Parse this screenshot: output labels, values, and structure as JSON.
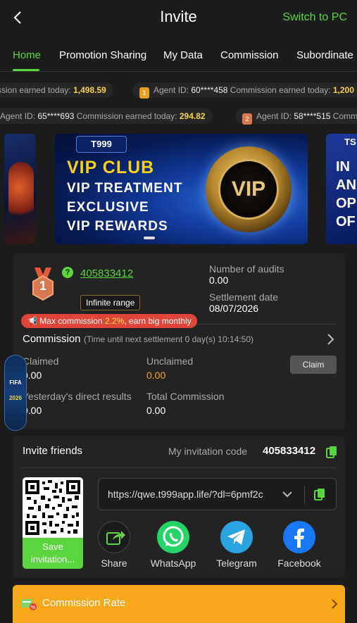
{
  "header": {
    "title": "Invite",
    "switch_label": "Switch to PC"
  },
  "tabs": [
    {
      "label": "Home"
    },
    {
      "label": "Promotion Sharing"
    },
    {
      "label": "My Data"
    },
    {
      "label": "Commission"
    },
    {
      "label": "Subordinate I"
    }
  ],
  "ticker_row1": [
    {
      "prefix": "ssion earned today:",
      "amount": "1,498.59"
    },
    {
      "medal": "1",
      "agent_label": "Agent ID:",
      "agent_id": "60****458",
      "earned_label": "Commission earned today:",
      "amount": "1,200"
    }
  ],
  "ticker_row2": [
    {
      "agent_label": "Agent ID:",
      "agent_id": "65****693",
      "earned_label": "Commission earned today:",
      "amount": "294.82"
    },
    {
      "medal": "2",
      "agent_label": "Agent ID:",
      "agent_id": "58****515",
      "earned_label": "Comm"
    }
  ],
  "banner": {
    "badge": "T999",
    "line1": "VIP CLUB",
    "line2": "VIP TREATMENT",
    "line3": "EXCLUSIVE",
    "line4": "VIP REWARDS",
    "coin_text": "VIP",
    "right_peek": [
      "TS",
      "IN",
      "AN",
      "OP",
      "OF"
    ]
  },
  "commission_card": {
    "level": "1",
    "help": "?",
    "agent_id": "405833412",
    "range_badge": "Infinite range",
    "audits_label": "Number of audits",
    "audits_value": "0.00",
    "settlement_label": "Settlement date",
    "settlement_value": "08/07/2026",
    "max_comm_prefix": "Max commission",
    "max_comm_pct": "2.2%",
    "max_comm_suffix": ", earn big monthly",
    "commission_title": "Commission",
    "commission_sub": "(Time until next settlement  0 day(s) 10:14:50)",
    "claimed_label": "Claimed",
    "claimed_value": "0.00",
    "unclaimed_label": "Unclaimed",
    "unclaimed_value": "0.00",
    "claim_button": "Claim",
    "yesterday_label": "Yesterday's direct results",
    "yesterday_value": "0.00",
    "total_label": "Total Commission",
    "total_value": "0.00"
  },
  "fifa_float": {
    "top": "FIFA",
    "bottom": "2026"
  },
  "invite": {
    "title": "Invite friends",
    "code_label": "My invitation code",
    "code": "405833412",
    "link": "https://qwe.t999app.life/?dl=6pmf2c",
    "qr_label": "Save invitation...",
    "share": [
      {
        "label": "Share",
        "icon": "share-icon"
      },
      {
        "label": "WhatsApp",
        "icon": "whatsapp-icon"
      },
      {
        "label": "Telegram",
        "icon": "telegram-icon"
      },
      {
        "label": "Facebook",
        "icon": "facebook-icon"
      }
    ]
  },
  "rate_bar": {
    "label": "Commission Rate"
  },
  "colors": {
    "accent_green": "#5ad53f",
    "gold": "#f5d44a",
    "orange": "#f7a71a",
    "red": "#e0453a"
  }
}
